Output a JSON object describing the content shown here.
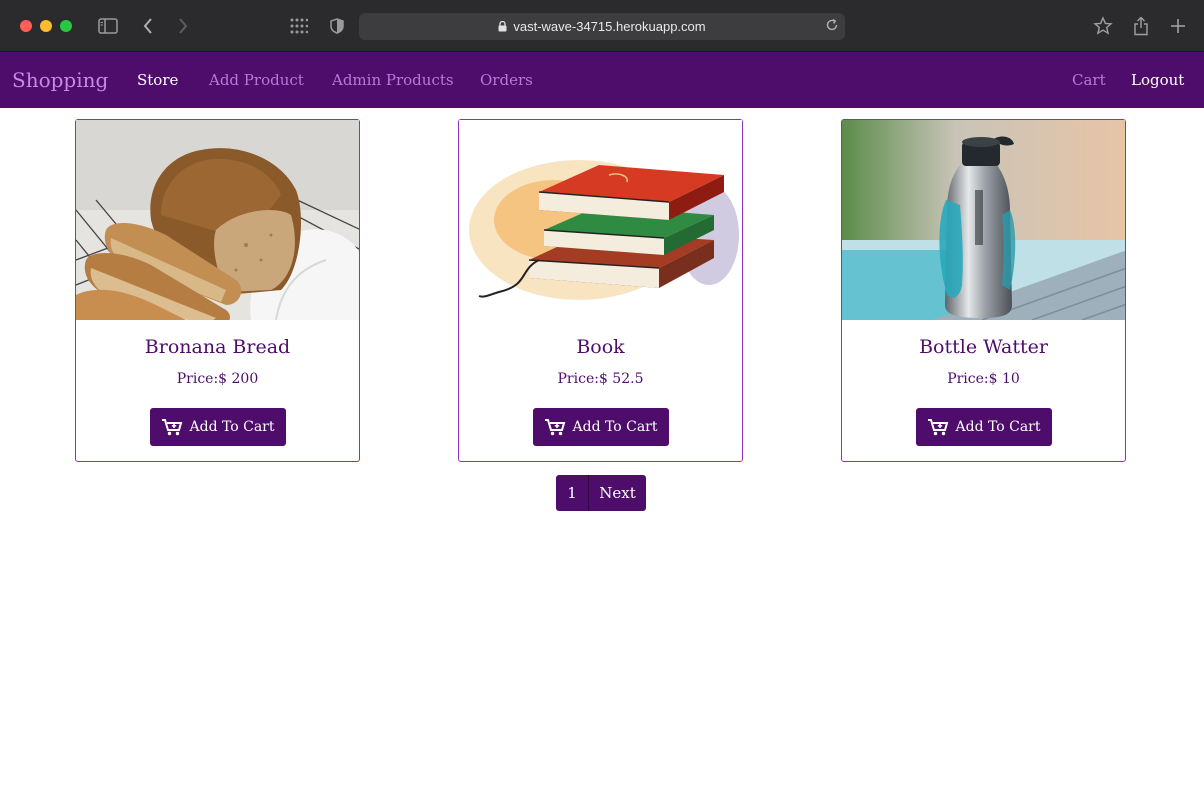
{
  "browser": {
    "url": "vast-wave-34715.herokuapp.com"
  },
  "navbar": {
    "brand": "Shopping",
    "links": [
      {
        "label": "Store"
      },
      {
        "label": "Add Product"
      },
      {
        "label": "Admin Products"
      },
      {
        "label": "Orders"
      }
    ],
    "cart": "Cart",
    "logout": "Logout"
  },
  "products": [
    {
      "title": "Bronana Bread",
      "price": "Price:$ 200",
      "button": "Add To Cart",
      "image": "bread-loaf"
    },
    {
      "title": "Book",
      "price": "Price:$ 52.5",
      "button": "Add To Cart",
      "image": "stack-of-books"
    },
    {
      "title": "Bottle Watter",
      "price": "Price:$ 10",
      "button": "Add To Cart",
      "image": "water-bottle"
    }
  ],
  "pagination": {
    "current": "1",
    "next": "Next"
  },
  "colors": {
    "primary": "#4e0c6b",
    "card_border": "#8e2fc0",
    "brand_text": "#c38ae6",
    "nav_link": "#b57ad8"
  }
}
